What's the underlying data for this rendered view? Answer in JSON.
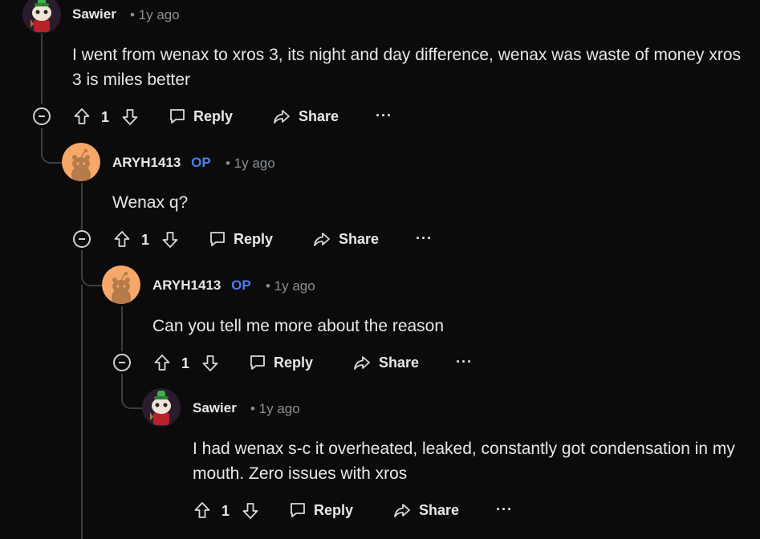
{
  "comments": [
    {
      "username": "Sawier",
      "op_label": "",
      "time": "• 1y ago",
      "text": "I went from wenax to xros 3, its night and day difference, wenax was waste of money xros 3 is miles better",
      "votes": "1",
      "reply_label": "Reply",
      "share_label": "Share",
      "more_label": "···"
    },
    {
      "username": "ARYH1413",
      "op_label": "OP",
      "time": "• 1y ago",
      "text": "Wenax q?",
      "votes": "1",
      "reply_label": "Reply",
      "share_label": "Share",
      "more_label": "···"
    },
    {
      "username": "ARYH1413",
      "op_label": "OP",
      "time": "• 1y ago",
      "text": "Can you tell me more about the reason",
      "votes": "1",
      "reply_label": "Reply",
      "share_label": "Share",
      "more_label": "···"
    },
    {
      "username": "Sawier",
      "op_label": "",
      "time": "• 1y ago",
      "text": "I had wenax s-c it overheated, leaked, constantly got condensation in my mouth. Zero issues with xros",
      "votes": "1",
      "reply_label": "Reply",
      "share_label": "Share",
      "more_label": "···"
    }
  ],
  "icons": {
    "upvote": "arrow-up-icon",
    "downvote": "arrow-down-icon",
    "reply": "comment-bubble-icon",
    "share": "share-arrow-icon",
    "collapse": "collapse-minus-icon"
  },
  "colors": {
    "background": "#0b0b0b",
    "op_badge": "#4f7df0",
    "thread_line": "#3b3f41",
    "snoo_avatar": "#f5a86a"
  }
}
